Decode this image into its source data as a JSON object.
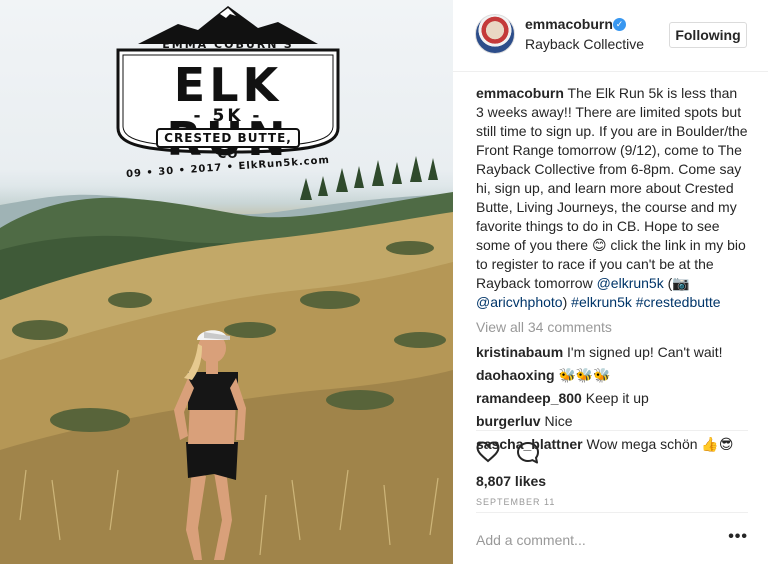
{
  "post": {
    "username": "emmacoburn",
    "verified_icon": "verified-badge-icon",
    "location": "Rayback Collective",
    "follow_label": "Following",
    "caption_user": "emmacoburn",
    "caption_text_1": " The Elk Run 5k is less than 3 weeks away!! There are limited spots but still time to sign up. If you are in Boulder/the Front Range tomorrow (9/12), come to The Rayback Collective from 6-8pm. Come say hi, sign up, and learn more about Crested Butte, Living Journeys, the course and my favorite things to do in CB. Hope to see some of you there 😊 click the link in my bio to register to race if you can't be at the Rayback tomorrow ",
    "mention_1": "@elkrun5k",
    "caption_text_2": " (📷 ",
    "mention_2": "@aricvhphoto",
    "caption_text_3": ") ",
    "hashtag_1": "#elkrun5k",
    "hashtag_2": "#crestedbutte",
    "view_all": "View all 34 comments",
    "comments": [
      {
        "user": "kristinabaum",
        "text": " I'm signed up! Can't wait!"
      },
      {
        "user": "daohaoxing",
        "text": " 🐝🐝🐝"
      },
      {
        "user": "ramandeep_800",
        "text": " Keep it up"
      },
      {
        "user": "burgerluv",
        "text": " Nice"
      },
      {
        "user": "sascha_blattner",
        "text": " Wow mega schön 👍😎"
      }
    ],
    "likes": "8,807 likes",
    "date": "SEPTEMBER 11",
    "add_comment_placeholder": "Add a comment...",
    "more_label": "•••"
  },
  "logo": {
    "arc_text": "EMMA COBURN'S",
    "title": "ELK RUN",
    "distance": "- 5K -",
    "place": "CRESTED BUTTE, CO",
    "date_line": "09 • 30 • 2017 • ElkRun5k.com"
  },
  "colors": {
    "link": "#003569",
    "verified": "#3897f0",
    "muted": "#999999"
  }
}
